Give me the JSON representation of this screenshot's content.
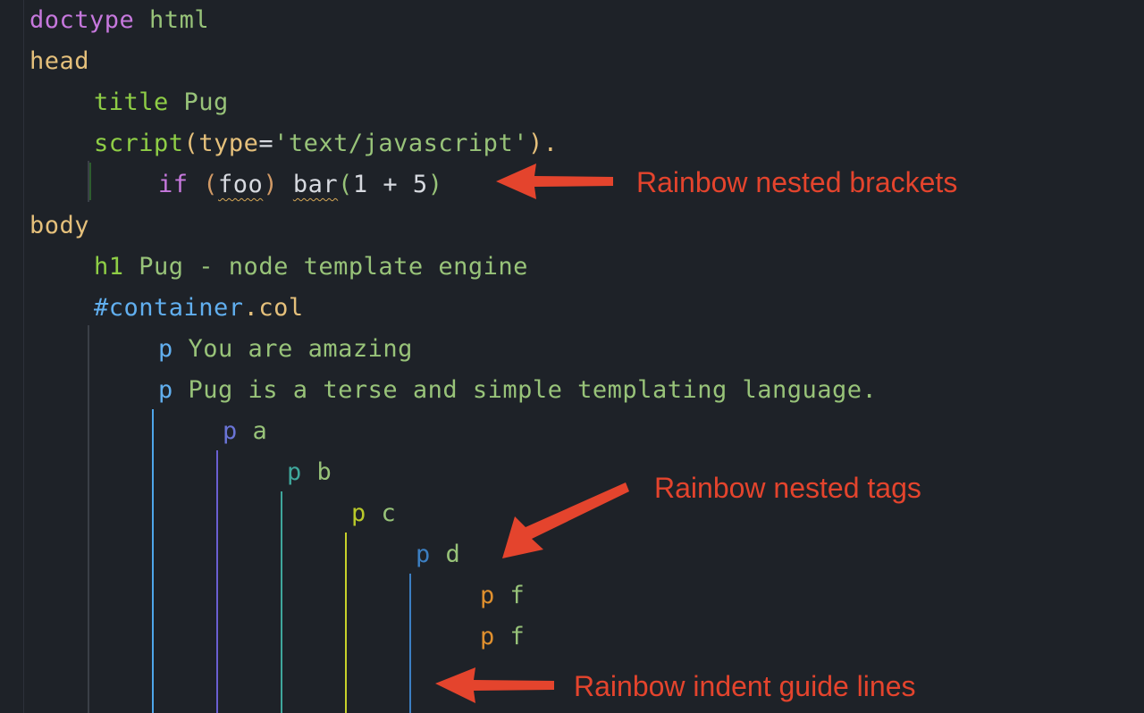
{
  "code_lines": [
    {
      "name": "line-doctype",
      "tokens": [
        {
          "t": "doctype",
          "c": "#c678dd"
        },
        {
          "t": " html",
          "c": "#98c379"
        }
      ]
    },
    {
      "name": "line-head",
      "tokens": [
        {
          "t": "head",
          "c": "#e5c07b"
        }
      ]
    },
    {
      "name": "line-title",
      "tokens": [
        {
          "t": "title",
          "c": "#8fce46"
        },
        {
          "t": " Pug",
          "c": "#98c379"
        }
      ]
    },
    {
      "name": "line-script",
      "tokens": [
        {
          "t": "script",
          "c": "#8fce46"
        },
        {
          "t": "(",
          "c": "#e5c07b"
        },
        {
          "t": "type",
          "c": "#e5c07b"
        },
        {
          "t": "=",
          "c": "#d7dae0"
        },
        {
          "t": "'text/javascript'",
          "c": "#98c379"
        },
        {
          "t": ").",
          "c": "#e5c07b"
        }
      ]
    },
    {
      "name": "line-if",
      "tokens": [
        {
          "t": "if",
          "c": "#c678dd"
        },
        {
          "t": " ",
          "c": "#d7dae0"
        },
        {
          "t": "(",
          "c": "#d19a66"
        },
        {
          "t": "foo",
          "c": "#d7dae0",
          "squiggle": true
        },
        {
          "t": ")",
          "c": "#d19a66"
        },
        {
          "t": " ",
          "c": "#d7dae0"
        },
        {
          "t": "bar",
          "c": "#d7dae0",
          "squiggle": true
        },
        {
          "t": "(",
          "c": "#98c379"
        },
        {
          "t": "1 + 5",
          "c": "#d7dae0"
        },
        {
          "t": ")",
          "c": "#98c379"
        }
      ]
    },
    {
      "name": "line-body",
      "tokens": [
        {
          "t": "body",
          "c": "#e5c07b"
        }
      ]
    },
    {
      "name": "line-h1",
      "tokens": [
        {
          "t": "h1",
          "c": "#8fce46"
        },
        {
          "t": " Pug - node template engine",
          "c": "#98c379"
        }
      ]
    },
    {
      "name": "line-container",
      "tokens": [
        {
          "t": "#container",
          "c": "#61afef"
        },
        {
          "t": ".col",
          "c": "#e5c07b"
        }
      ]
    },
    {
      "name": "line-p-amazing",
      "tokens": [
        {
          "t": "p",
          "c": "#61afef"
        },
        {
          "t": " You are amazing",
          "c": "#98c379"
        }
      ]
    },
    {
      "name": "line-p-pug",
      "tokens": [
        {
          "t": "p",
          "c": "#61afef"
        },
        {
          "t": " Pug is a terse and simple templating language.",
          "c": "#98c379"
        }
      ]
    },
    {
      "name": "line-p-a",
      "tokens": [
        {
          "t": "p",
          "c": "#6a74d6"
        },
        {
          "t": " a",
          "c": "#98c379"
        }
      ]
    },
    {
      "name": "line-p-b",
      "tokens": [
        {
          "t": "p",
          "c": "#3fa79c"
        },
        {
          "t": " b",
          "c": "#98c379"
        }
      ]
    },
    {
      "name": "line-p-c",
      "tokens": [
        {
          "t": "p",
          "c": "#b9c92a"
        },
        {
          "t": " c",
          "c": "#98c379"
        }
      ]
    },
    {
      "name": "line-p-d",
      "tokens": [
        {
          "t": "p",
          "c": "#3c7fc2"
        },
        {
          "t": " d",
          "c": "#98c379"
        }
      ]
    },
    {
      "name": "line-p-f-1",
      "tokens": [
        {
          "t": "p",
          "c": "#e0902e"
        },
        {
          "t": " f",
          "c": "#98c379"
        }
      ]
    },
    {
      "name": "line-p-f-2",
      "tokens": [
        {
          "t": "p",
          "c": "#e0902e"
        },
        {
          "t": " f",
          "c": "#98c379"
        }
      ]
    }
  ],
  "indent_guides": [
    {
      "color": "#3a3f47"
    },
    {
      "color": "#3a3f47"
    },
    {
      "color": "#4ea6ea"
    },
    {
      "color": "#6a5fd1"
    },
    {
      "color": "#3fa79c"
    },
    {
      "color": "#c7d12a"
    },
    {
      "color": "#3c7fc2"
    },
    {
      "color": "#2e5d2f"
    }
  ],
  "annotations": {
    "brackets": "Rainbow nested brackets",
    "tags": "Rainbow nested tags",
    "guides": "Rainbow indent guide lines"
  },
  "colors": {
    "background": "#1e2228",
    "annotation": "#e4442d"
  }
}
